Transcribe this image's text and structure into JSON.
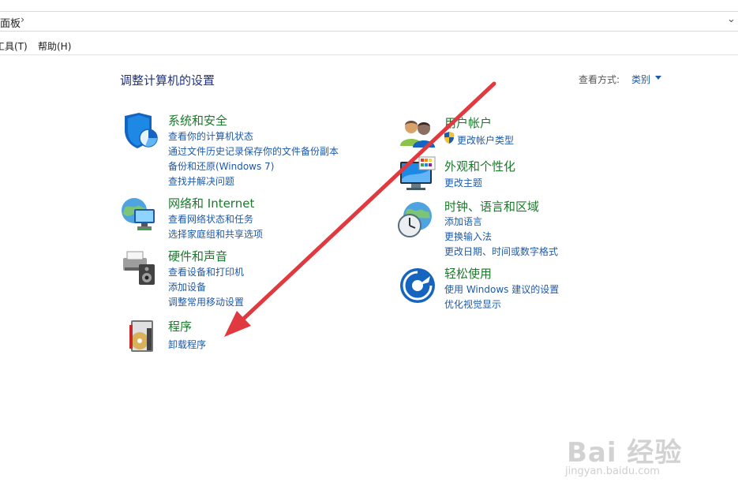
{
  "address_bar": {
    "path_text": "面板",
    "separator": "›"
  },
  "menu": {
    "tools": "工具(T)",
    "help": "帮助(H)"
  },
  "header": {
    "title": "调整计算机的设置",
    "view_label": "查看方式:",
    "view_value": "类别"
  },
  "left_categories": [
    {
      "title": "系统和安全",
      "links": [
        "查看你的计算机状态",
        "通过文件历史记录保存你的文件备份副本",
        "备份和还原(Windows 7)",
        "查找并解决问题"
      ]
    },
    {
      "title": "网络和 Internet",
      "links": [
        "查看网络状态和任务",
        "选择家庭组和共享选项"
      ]
    },
    {
      "title": "硬件和声音",
      "links": [
        "查看设备和打印机",
        "添加设备",
        "调整常用移动设置"
      ]
    },
    {
      "title": "程序",
      "links": [
        "卸载程序"
      ]
    }
  ],
  "right_categories": [
    {
      "title": "用户帐户",
      "links": [
        "更改帐户类型"
      ]
    },
    {
      "title": "外观和个性化",
      "links": [
        "更改主题"
      ]
    },
    {
      "title": "时钟、语言和区域",
      "links": [
        "添加语言",
        "更换输入法",
        "更改日期、时间或数字格式"
      ]
    },
    {
      "title": "轻松使用",
      "links": [
        "使用 Windows 建议的设置",
        "优化视觉显示"
      ]
    }
  ],
  "colors": {
    "link": "#1e5aa8",
    "category_title": "#1a7a2a",
    "page_title": "#1e3287",
    "annotation_arrow": "#e0393f"
  },
  "watermark": {
    "main": "Bai 经验",
    "sub": "jingyan.baidu.com"
  }
}
